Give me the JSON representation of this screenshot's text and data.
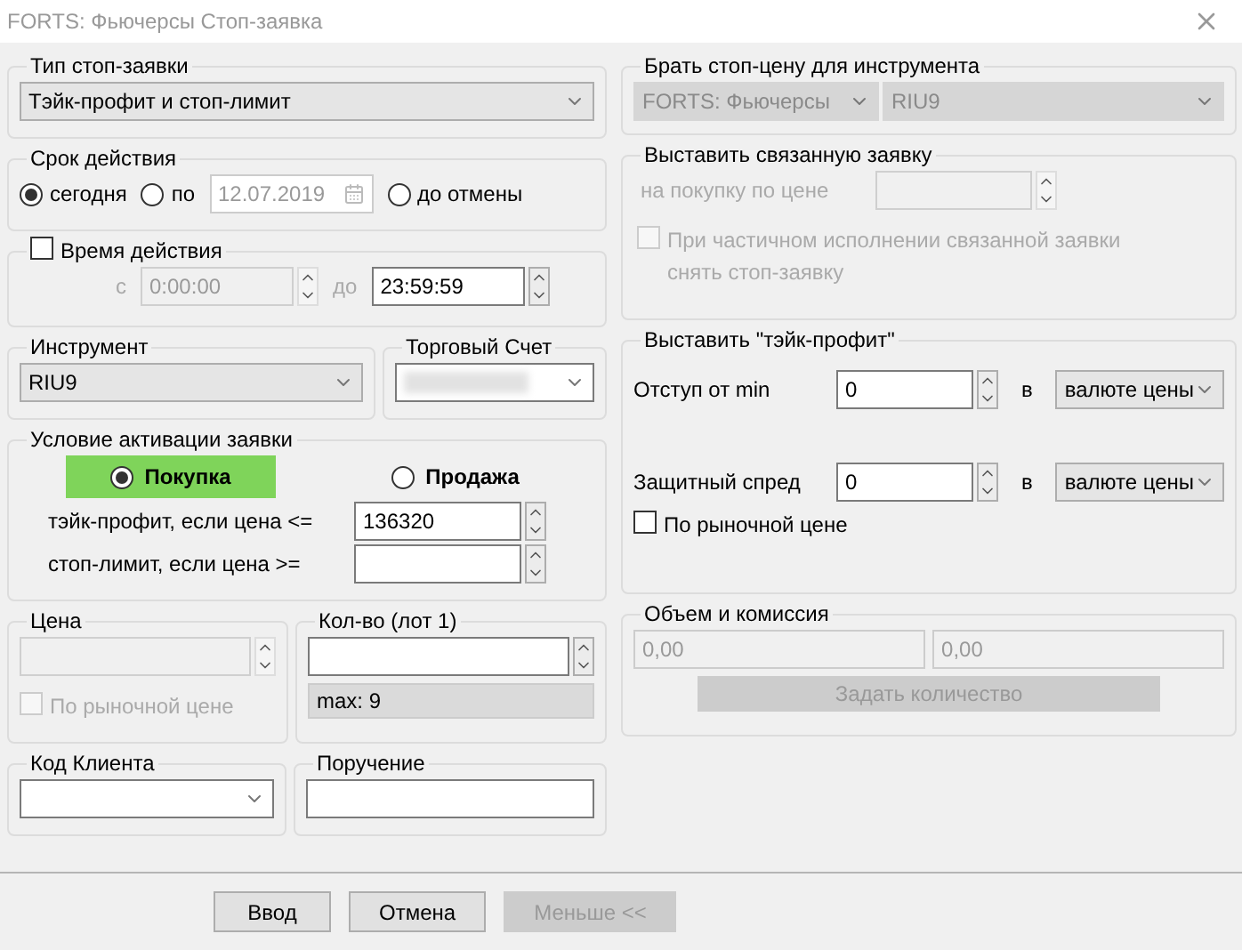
{
  "window": {
    "title": "FORTS: Фьючерсы Стоп-заявка"
  },
  "order_type": {
    "label": "Тип стоп-заявки",
    "value": "Тэйк-профит и стоп-лимит"
  },
  "validity": {
    "label": "Срок действия",
    "date": "12.07.2019",
    "options": [
      {
        "label": "сегодня",
        "selected": true
      },
      {
        "label": "по",
        "selected": false
      },
      {
        "label": "до отмены",
        "selected": false
      }
    ]
  },
  "time": {
    "label": "Время действия",
    "checked": false,
    "from_label": "с",
    "from": "0:00:00",
    "to_label": "до",
    "to": "23:59:59"
  },
  "instrument": {
    "label": "Инструмент",
    "value": "RIU9"
  },
  "account": {
    "label": "Торговый Счет"
  },
  "activation": {
    "label": "Условие активации заявки",
    "sides": [
      {
        "label": "Покупка",
        "selected": true
      },
      {
        "label": "Продажа",
        "selected": false
      }
    ],
    "rows": [
      {
        "label": "тэйк-профит, если цена <=",
        "value": "136320"
      },
      {
        "label": "стоп-лимит, если цена >="
      }
    ]
  },
  "price": {
    "label": "Цена",
    "market": {
      "label": "По рыночной цене",
      "checked": false,
      "disabled": true
    }
  },
  "quantity": {
    "label": "Кол-во (лот 1)",
    "max": "max: 9"
  },
  "client_code": {
    "label": "Код Клиента"
  },
  "instruction": {
    "label": "Поручение"
  },
  "stop_price_source": {
    "label": "Брать стоп-цену для инструмента",
    "market": "FORTS: Фьючерсы",
    "instrument": "RIU9"
  },
  "linked_order": {
    "label": "Выставить связанную заявку",
    "price_label": "на покупку по цене",
    "cancel": {
      "label": "При частичном исполнении связанной заявки снять стоп-заявку",
      "checked": false
    }
  },
  "take_profit": {
    "label": "Выставить \"тэйк-профит\"",
    "rows": [
      {
        "label": "Отступ от min",
        "value": "0",
        "unit_label": "в",
        "unit": "валюте цены"
      },
      {
        "label": "Защитный спред",
        "value": "0",
        "unit_label": "в",
        "unit": "валюте цены"
      }
    ],
    "market": {
      "label": "По рыночной цене",
      "checked": false
    }
  },
  "volume": {
    "label": "Объем и комиссия",
    "values": [
      "0,00",
      "0,00"
    ],
    "button": "Задать количество"
  },
  "buttons": [
    {
      "label": "Ввод",
      "disabled": false
    },
    {
      "label": "Отмена",
      "disabled": false
    },
    {
      "label": "Меньше <<",
      "disabled": true
    }
  ]
}
